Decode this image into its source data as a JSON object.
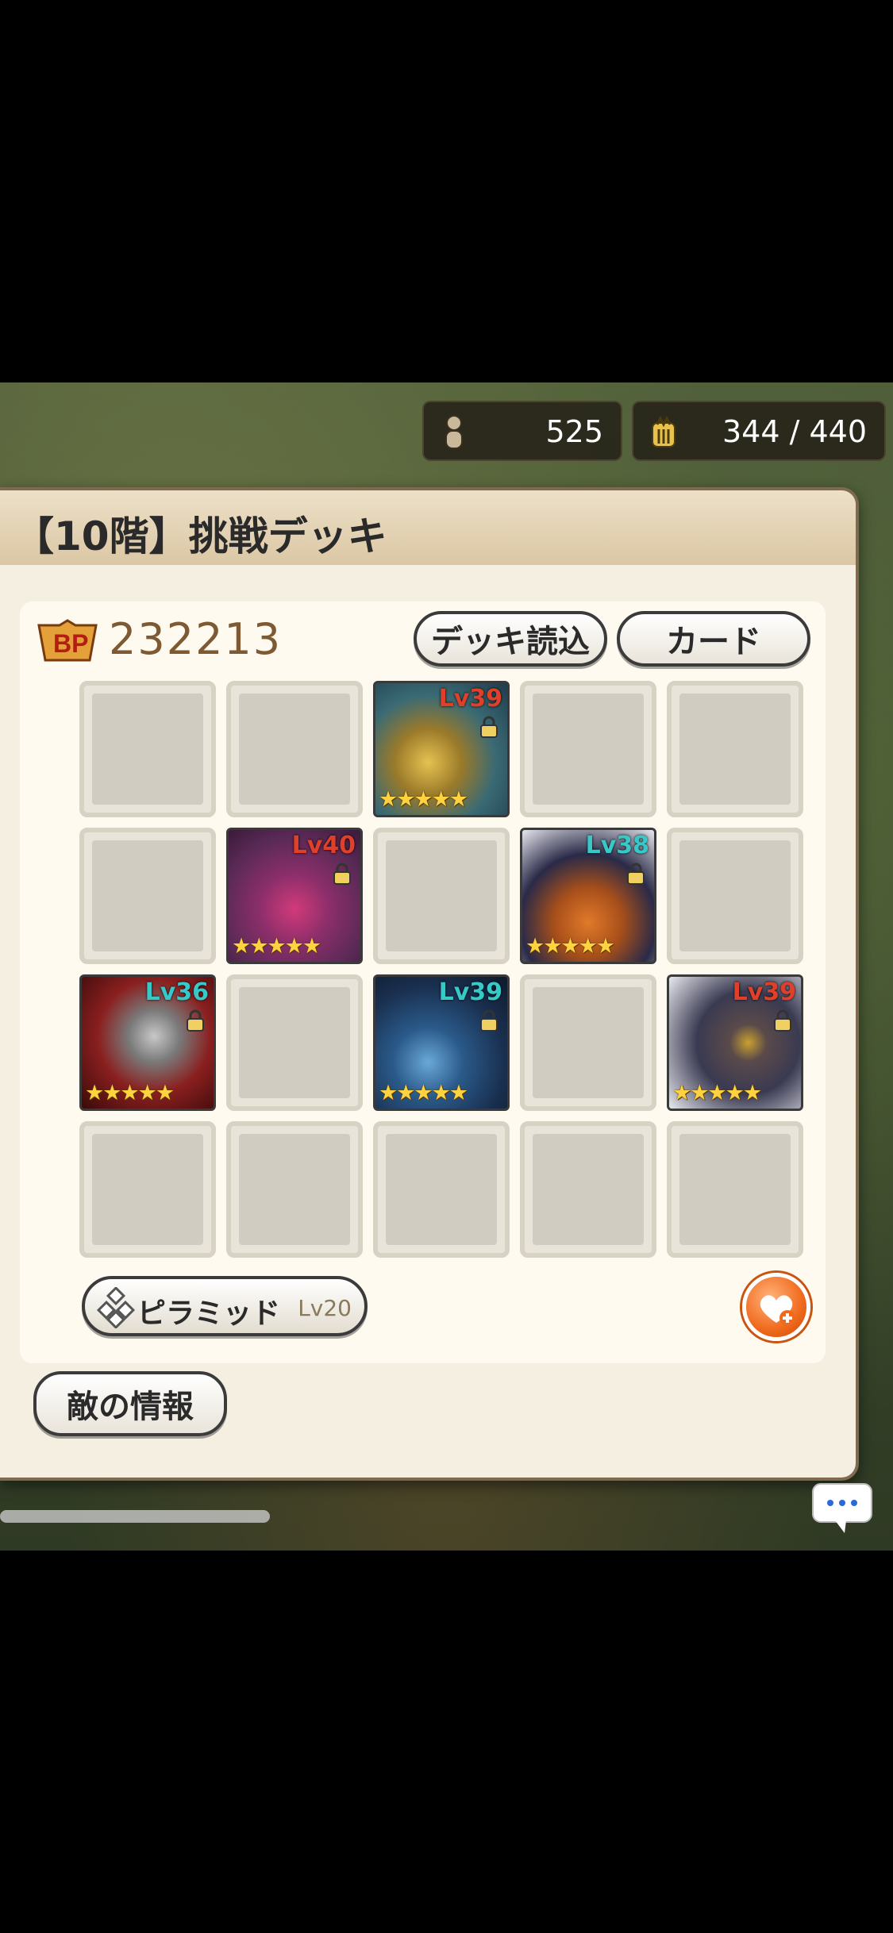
{
  "header_stats": {
    "stamina_value": "525",
    "capacity_value": "344 / 440"
  },
  "panel": {
    "title": "【10階】挑戦デッキ",
    "bp_value": "232213",
    "load_deck_label": "デッキ読込",
    "card_label": "カード",
    "formation_label": "ピラミッド",
    "formation_level": "Lv20",
    "enemy_info_label": "敵の情報"
  },
  "cards": [
    {
      "name": "blue-fish-monster",
      "level": "Lv39",
      "level_color": "#e0402a",
      "stars": "★★★★★"
    },
    {
      "name": "purple-spider-monster",
      "level": "Lv40",
      "level_color": "#e0402a",
      "stars": "★★★★★"
    },
    {
      "name": "pumpkin-monster",
      "level": "Lv38",
      "level_color": "#37c9c8",
      "stars": "★★★★★"
    },
    {
      "name": "skeleton-reaper",
      "level": "Lv36",
      "level_color": "#37c9c8",
      "stars": "★★★★★"
    },
    {
      "name": "dark-blue-fish-monster",
      "level": "Lv39",
      "level_color": "#37c9c8",
      "stars": "★★★★★"
    },
    {
      "name": "octopus-monster",
      "level": "Lv39",
      "level_color": "#e0402a",
      "stars": "★★★★★"
    }
  ],
  "icons": {
    "stamina": "person-icon",
    "capacity": "crown-icon",
    "bp": "bp-badge-icon",
    "lock": "lock-icon",
    "formation": "pyramid-icon",
    "heart": "heart-plus-icon",
    "chat": "chat-bubble-icon"
  }
}
